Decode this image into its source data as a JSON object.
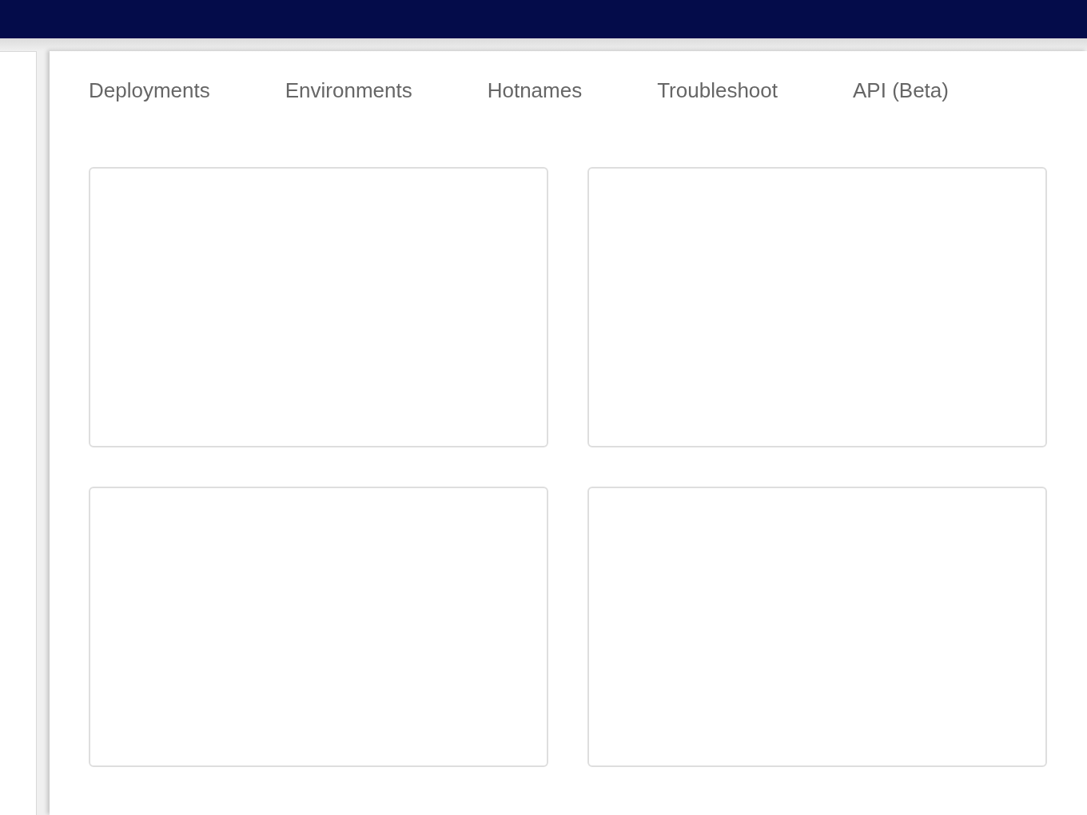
{
  "tabs": [
    {
      "label": "Deployments"
    },
    {
      "label": "Environments"
    },
    {
      "label": "Hotnames"
    },
    {
      "label": "Troubleshoot"
    },
    {
      "label": "API (Beta)"
    }
  ],
  "cards": [
    {
      "kind": "empty"
    },
    {
      "kind": "empty"
    },
    {
      "kind": "empty"
    },
    {
      "kind": "empty"
    }
  ]
}
